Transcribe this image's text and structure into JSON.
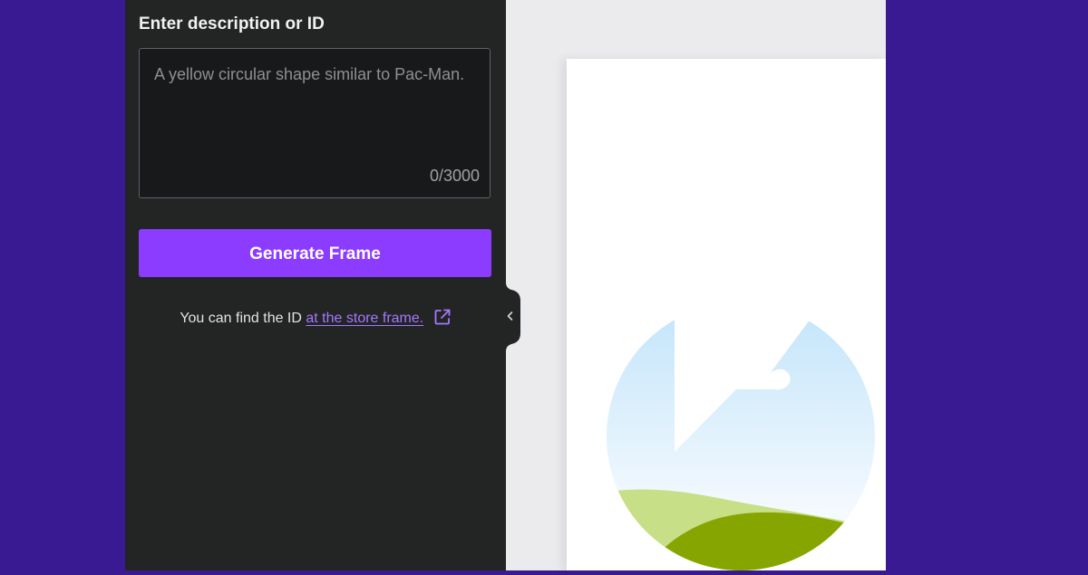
{
  "form": {
    "label": "Enter description or ID",
    "textarea": {
      "value": "",
      "placeholder": "A yellow circular shape similar to Pac-Man.",
      "counter": "0/3000"
    },
    "generate_button": "Generate Frame"
  },
  "help": {
    "prefix": "You can find the ID",
    "link_text": "at the store frame."
  },
  "icons": {
    "external_link": "external-link-icon",
    "collapse": "chevron-left-icon",
    "preview": "image-placeholder-icon"
  },
  "colors": {
    "background": "#3a1a93",
    "panel": "#232424",
    "accent": "#8c3cff",
    "link": "#a578ff",
    "canvas": "#ebebee",
    "frame": "#ffffff",
    "hill_light": "#c7df86",
    "hill_dark": "#87a500",
    "sky": "#cde9fb"
  }
}
